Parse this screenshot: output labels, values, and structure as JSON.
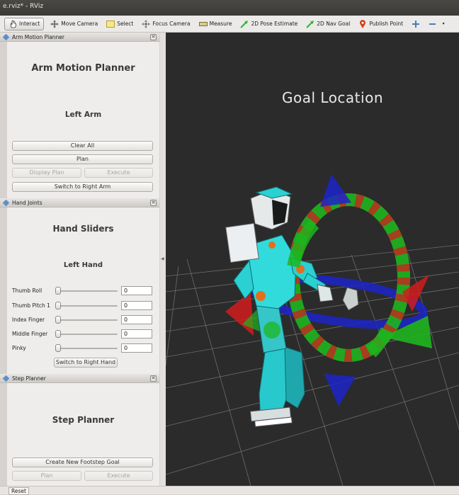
{
  "window": {
    "title": "e.rviz* - RViz"
  },
  "toolbar": {
    "tools": [
      {
        "label": "Interact",
        "icon": "hand-pointer-icon"
      },
      {
        "label": "Move Camera",
        "icon": "move-camera-icon"
      },
      {
        "label": "Select",
        "icon": "select-rectangle-icon"
      },
      {
        "label": "Focus Camera",
        "icon": "focus-camera-icon"
      },
      {
        "label": "Measure",
        "icon": "ruler-icon"
      },
      {
        "label": "2D Pose Estimate",
        "icon": "green-arrow-icon"
      },
      {
        "label": "2D Nav Goal",
        "icon": "green-arrow-icon"
      },
      {
        "label": "Publish Point",
        "icon": "map-pin-icon"
      }
    ]
  },
  "arm_panel": {
    "dock_title": "Arm Motion Planner",
    "heading": "Arm Motion Planner",
    "subheading": "Left Arm",
    "buttons": {
      "clear_all": "Clear All",
      "plan": "Plan",
      "display_plan": "Display Plan",
      "execute": "Execute",
      "switch_arm": "Switch to Right Arm"
    }
  },
  "hand_panel": {
    "dock_title": "Hand Joints",
    "heading": "Hand Sliders",
    "subheading": "Left Hand",
    "sliders": [
      {
        "label": "Thumb Roll",
        "value": "0"
      },
      {
        "label": "Thumb Pitch 1",
        "value": "0"
      },
      {
        "label": "Index Finger",
        "value": "0"
      },
      {
        "label": "Middle Finger",
        "value": "0"
      },
      {
        "label": "Pinky",
        "value": "0"
      }
    ],
    "switch_hand": "Switch to Right Hand"
  },
  "step_panel": {
    "dock_title": "Step Planner",
    "heading": "Step Planner",
    "buttons": {
      "create_goal": "Create New Footstep Goal",
      "plan": "Plan",
      "execute": "Execute"
    }
  },
  "viewport": {
    "label": "Goal  Location"
  },
  "bottom": {
    "reset": "Reset"
  },
  "colors": {
    "background3d": "#2b2b2b",
    "ring_red": "#d21c1c",
    "ring_green": "#1fb51f",
    "ring_blue": "#1c24c8",
    "robot_cyan": "#28d6d6"
  }
}
